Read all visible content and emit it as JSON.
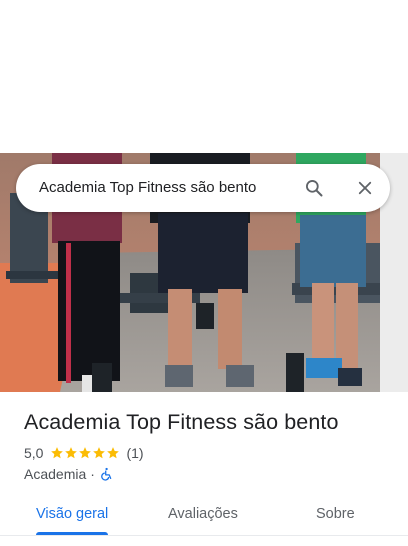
{
  "search": {
    "query": "Academia Top Fitness são bento"
  },
  "place": {
    "name": "Academia Top Fitness são bento",
    "rating": "5,0",
    "stars": 5,
    "review_count": "(1)",
    "category": "Academia",
    "separator": "·",
    "accessibility_icon": "wheelchair-accessible-icon"
  },
  "tabs": [
    {
      "label": "Visão geral",
      "active": true
    },
    {
      "label": "Avaliações",
      "active": false
    },
    {
      "label": "Sobre",
      "active": false
    }
  ],
  "colors": {
    "accent": "#1a73e8",
    "star": "#fbbc04",
    "text_primary": "#202124",
    "text_secondary": "#4d5156"
  },
  "icons": [
    "search-icon",
    "close-icon",
    "star-icon",
    "wheelchair-accessible-icon"
  ]
}
